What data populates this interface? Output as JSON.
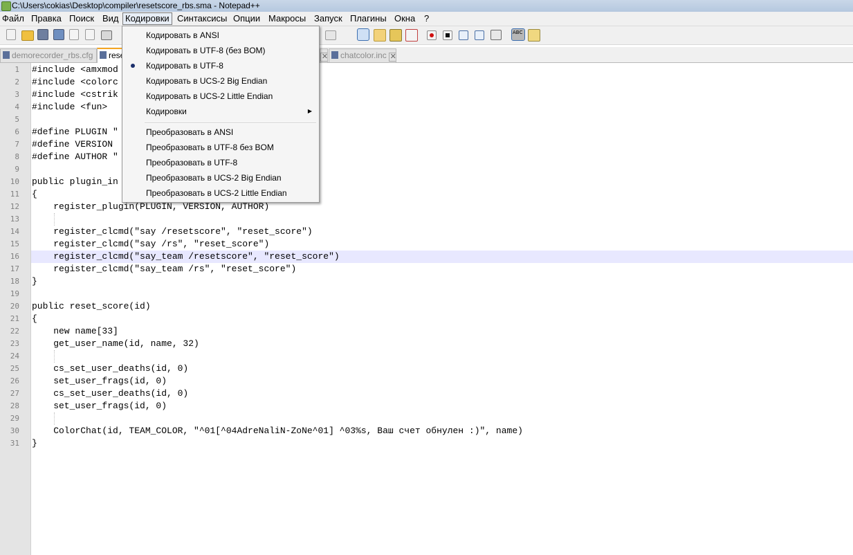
{
  "window": {
    "title": "C:\\Users\\cokias\\Desktop\\compiler\\resetscore_rbs.sma - Notepad++"
  },
  "menubar": [
    "Файл",
    "Правка",
    "Поиск",
    "Вид",
    "Кодировки",
    "Синтаксисы",
    "Опции",
    "Макросы",
    "Запуск",
    "Плагины",
    "Окна",
    "?"
  ],
  "tabs": [
    {
      "label": "demorecorder_rbs.cfg",
      "active": false
    },
    {
      "label": "rese",
      "active": true
    },
    {
      "label": "chatcolor.inc",
      "active": false
    }
  ],
  "encoding_menu": {
    "items": [
      {
        "label": "Кодировать в ANSI"
      },
      {
        "label": "Кодировать в UTF-8 (без BOM)"
      },
      {
        "label": "Кодировать в UTF-8",
        "checked": true
      },
      {
        "label": "Кодировать в UCS-2 Big Endian"
      },
      {
        "label": "Кодировать в UCS-2 Little Endian"
      },
      {
        "label": "Кодировки",
        "submenu": true
      },
      {
        "label": "Преобразовать в ANSI"
      },
      {
        "label": "Преобразовать в UTF-8 без BOM"
      },
      {
        "label": "Преобразовать в UTF-8"
      },
      {
        "label": "Преобразовать в UCS-2 Big Endian"
      },
      {
        "label": "Преобразовать в UCS-2 Little Endian"
      }
    ]
  },
  "editor": {
    "current_line": 16,
    "lines": [
      {
        "n": "1",
        "text": "#include <amxmod"
      },
      {
        "n": "2",
        "text": "#include <colorc"
      },
      {
        "n": "3",
        "text": "#include <cstrik"
      },
      {
        "n": "4",
        "text": "#include <fun>"
      },
      {
        "n": "5",
        "text": ""
      },
      {
        "n": "6",
        "text": "#define PLUGIN \""
      },
      {
        "n": "7",
        "text": "#define VERSION"
      },
      {
        "n": "8",
        "text": "#define AUTHOR \""
      },
      {
        "n": "9",
        "text": ""
      },
      {
        "n": "10",
        "text": "public plugin_in"
      },
      {
        "n": "11",
        "text": "{"
      },
      {
        "n": "12",
        "text": "    register_plugin(PLUGIN, VERSION, AUTHOR)"
      },
      {
        "n": "13",
        "text": ""
      },
      {
        "n": "14",
        "text": "    register_clcmd(\"say /resetscore\", \"reset_score\")"
      },
      {
        "n": "15",
        "text": "    register_clcmd(\"say /rs\", \"reset_score\")"
      },
      {
        "n": "16",
        "text": "    register_clcmd(\"say_team /resetscore\", \"reset_score\")"
      },
      {
        "n": "17",
        "text": "    register_clcmd(\"say_team /rs\", \"reset_score\")"
      },
      {
        "n": "18",
        "text": "}"
      },
      {
        "n": "19",
        "text": ""
      },
      {
        "n": "20",
        "text": "public reset_score(id)"
      },
      {
        "n": "21",
        "text": "{"
      },
      {
        "n": "22",
        "text": "    new name[33]"
      },
      {
        "n": "23",
        "text": "    get_user_name(id, name, 32)"
      },
      {
        "n": "24",
        "text": ""
      },
      {
        "n": "25",
        "text": "    cs_set_user_deaths(id, 0)"
      },
      {
        "n": "26",
        "text": "    set_user_frags(id, 0)"
      },
      {
        "n": "27",
        "text": "    cs_set_user_deaths(id, 0)"
      },
      {
        "n": "28",
        "text": "    set_user_frags(id, 0)"
      },
      {
        "n": "29",
        "text": ""
      },
      {
        "n": "30",
        "text": "    ColorChat(id, TEAM_COLOR, \"^01[^04AdreNaliN-ZoNe^01] ^03%s, Ваш счет обнулен :)\", name)"
      },
      {
        "n": "31",
        "text": "}"
      }
    ]
  },
  "icons": {
    "toolbar": [
      "new-file-icon",
      "open-file-icon",
      "save-icon",
      "save-all-icon",
      "close-icon",
      "close-all-icon",
      "print-icon",
      "word-wrap-icon",
      "show-all-chars-icon",
      "indent-guide-icon",
      "folder-icon",
      "function-list-icon",
      "record-macro-icon",
      "stop-macro-icon",
      "play-macro-icon",
      "run-macro-multiple-icon",
      "save-macro-icon",
      "spell-check-icon",
      "spell-settings-icon"
    ]
  }
}
